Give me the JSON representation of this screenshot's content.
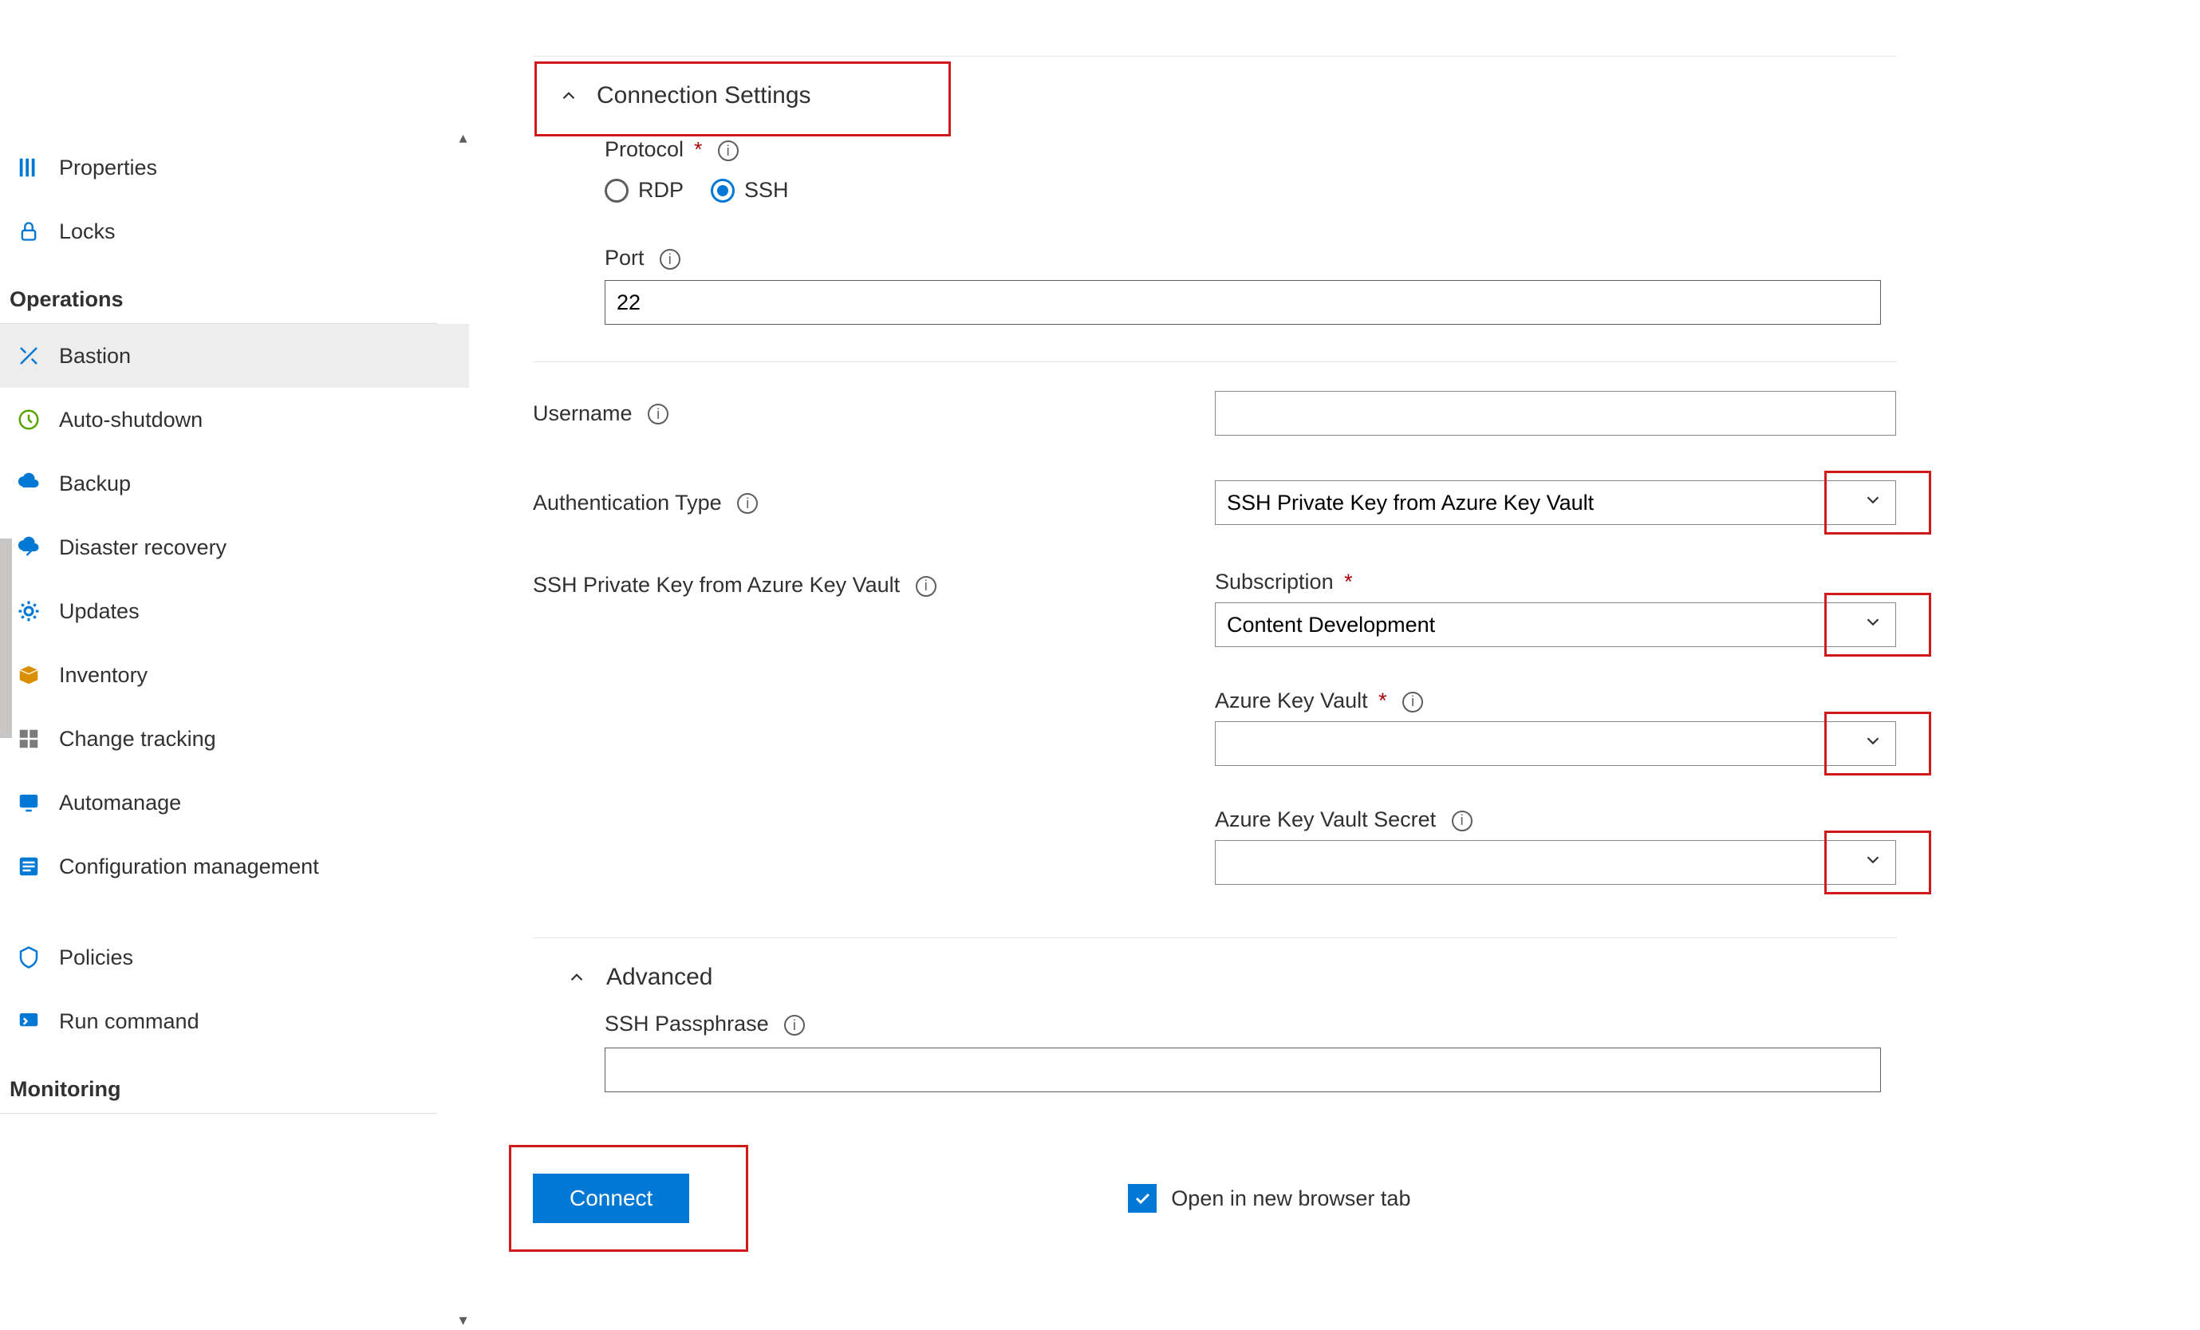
{
  "sidebar": {
    "items_top": [
      {
        "label": "Properties"
      },
      {
        "label": "Locks"
      }
    ],
    "section_operations": "Operations",
    "items_ops": [
      {
        "label": "Bastion",
        "selected": true
      },
      {
        "label": "Auto-shutdown"
      },
      {
        "label": "Backup"
      },
      {
        "label": "Disaster recovery"
      },
      {
        "label": "Updates"
      },
      {
        "label": "Inventory"
      },
      {
        "label": "Change tracking"
      },
      {
        "label": "Automanage"
      },
      {
        "label": "Configuration management"
      }
    ],
    "items_ops_gap": [
      {
        "label": "Policies"
      },
      {
        "label": "Run command"
      }
    ],
    "section_monitoring": "Monitoring"
  },
  "main": {
    "connection_settings": "Connection Settings",
    "protocol_label": "Protocol",
    "protocol_rdp": "RDP",
    "protocol_ssh": "SSH",
    "port_label": "Port",
    "port_value": "22",
    "username_label": "Username",
    "username_value": "",
    "auth_type_label": "Authentication Type",
    "auth_type_value": "SSH Private Key from Azure Key Vault",
    "kv_section_label": "SSH Private Key from Azure Key Vault",
    "subscription_label": "Subscription",
    "subscription_value": "Content Development",
    "akv_label": "Azure Key Vault",
    "akv_value": "",
    "akv_secret_label": "Azure Key Vault Secret",
    "akv_secret_value": "",
    "advanced_label": "Advanced",
    "passphrase_label": "SSH Passphrase",
    "passphrase_value": "",
    "connect_button": "Connect",
    "open_new_tab": "Open in new browser tab"
  }
}
